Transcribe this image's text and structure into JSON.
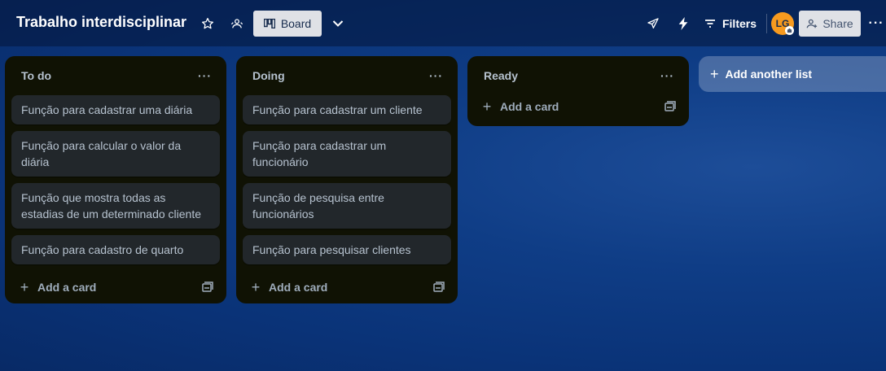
{
  "header": {
    "board_title": "Trabalho interdisciplinar",
    "view_label": "Board",
    "filters_label": "Filters",
    "avatar_initials": "LG",
    "share_label": "Share",
    "more": "···"
  },
  "lists": [
    {
      "title": "To do",
      "menu": "···",
      "cards": [
        "Função para cadastrar uma diária",
        "Função para calcular o valor da diária",
        "Função que mostra todas as estadias de um determinado cliente",
        "Função para cadastro de quarto"
      ],
      "add_card_label": "Add a card"
    },
    {
      "title": "Doing",
      "menu": "···",
      "cards": [
        "Função para cadastrar um cliente",
        "Função para cadastrar um funcionário",
        "Função de pesquisa entre funcionários",
        "Função para pesquisar clientes"
      ],
      "add_card_label": "Add a card"
    },
    {
      "title": "Ready",
      "menu": "···",
      "cards": [],
      "add_card_label": "Add a card"
    }
  ],
  "add_list_label": "Add another list",
  "colors": {
    "board_bg": "#0f3d86",
    "list_bg": "#101204",
    "card_bg": "#22272b",
    "avatar_bg": "#f79a1f"
  },
  "icons": {
    "star": "star-icon",
    "visibility": "workspace-visibility-icon",
    "board_view": "board-view-icon",
    "chevron": "chevron-down-icon",
    "rocket": "power-ups-icon",
    "bolt": "automation-icon",
    "filter": "filter-icon",
    "share": "add-member-icon",
    "template": "card-template-icon"
  }
}
